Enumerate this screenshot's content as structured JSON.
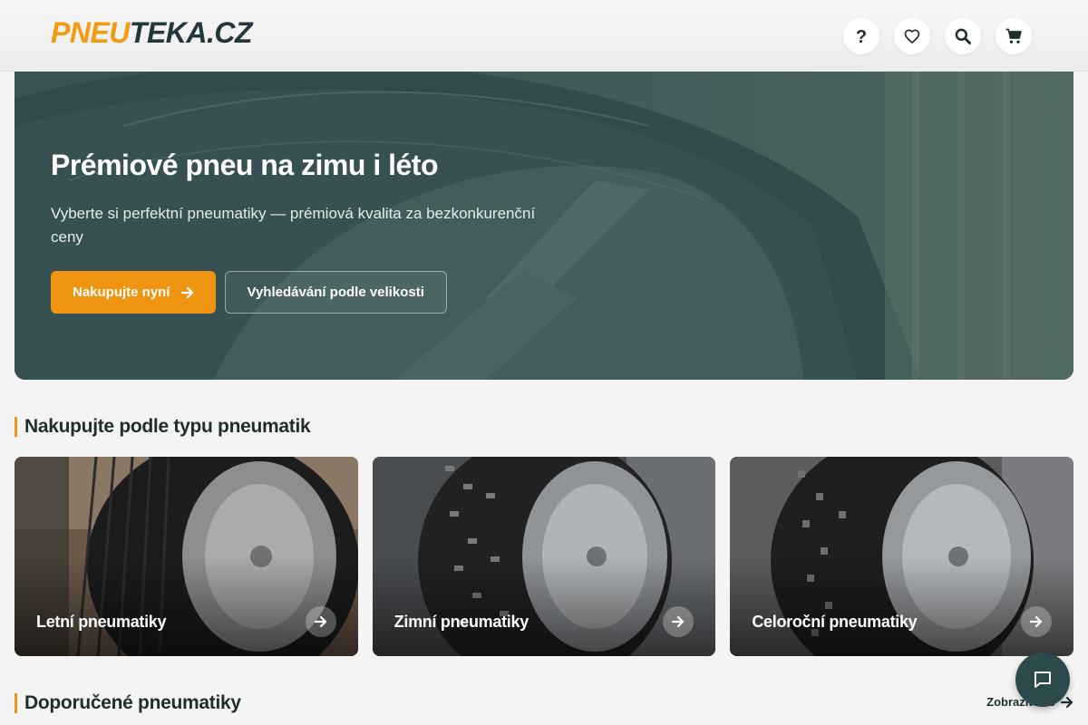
{
  "header": {
    "logo_part1": "PNEU",
    "logo_part2": "TEKA.CZ",
    "icons": [
      "help-icon",
      "heart-icon",
      "search-icon",
      "cart-icon"
    ]
  },
  "hero": {
    "title": "Prémiové pneu na zimu i léto",
    "subtitle": "Vyberte si perfektní pneumatiky — prémiová kvalita za bezkonkurenční ceny",
    "primary_button": "Nakupujte nyní",
    "secondary_button": "Vyhledávání podle velikosti"
  },
  "type_section": {
    "title": "Nakupujte podle typu pneumatik",
    "cards": [
      {
        "label": "Letní pneumatiky"
      },
      {
        "label": "Zimní pneumatiky"
      },
      {
        "label": "Celoroční pneumatiky"
      }
    ]
  },
  "recommended_section": {
    "title": "Doporučené pneumatiky",
    "show_all": "Zobrazit vše"
  },
  "colors": {
    "accent": "#ee9410",
    "dark": "#23383c",
    "chat": "#2c4a4c"
  }
}
